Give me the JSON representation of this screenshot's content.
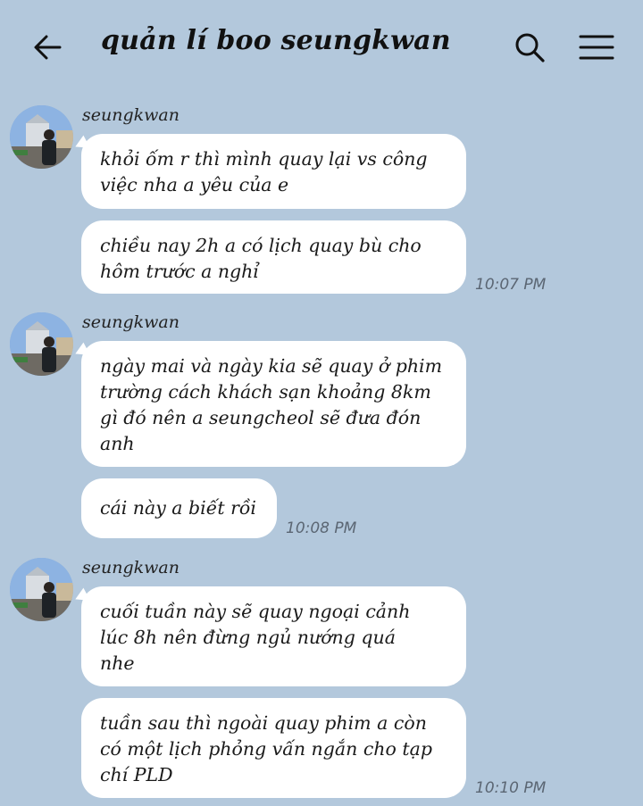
{
  "header": {
    "title": "quản lí boo seungkwan",
    "back_icon": "arrow-left-icon",
    "search_icon": "search-icon",
    "menu_icon": "hamburger-menu-icon"
  },
  "groups": [
    {
      "sender": "seungkwan",
      "messages": [
        "khỏi ốm r thì mình quay lại vs công\nviệc nha a yêu của e",
        "chiều nay 2h a có lịch quay bù cho\nhôm trước a nghỉ"
      ],
      "time": "10:07 PM"
    },
    {
      "sender": "seungkwan",
      "messages": [
        "ngày mai và ngày kia sẽ quay ở phim\ntrường cách khách sạn khoảng 8km\ngì đó nên a seungcheol sẽ đưa đón\nanh",
        "cái này a biết rồi"
      ],
      "time": "10:08 PM"
    },
    {
      "sender": "seungkwan",
      "messages": [
        "cuối tuần này sẽ quay ngoại cảnh\nlúc 8h nên đừng ngủ nướng quá\nnhe",
        "tuần sau thì ngoài quay phim a còn\ncó một lịch phỏng vấn ngắn cho tạp\nchí PLD"
      ],
      "time": "10:10 PM"
    }
  ],
  "colors": {
    "background": "#b3c8dc",
    "bubble": "#ffffff",
    "time_text": "#5b6673"
  }
}
